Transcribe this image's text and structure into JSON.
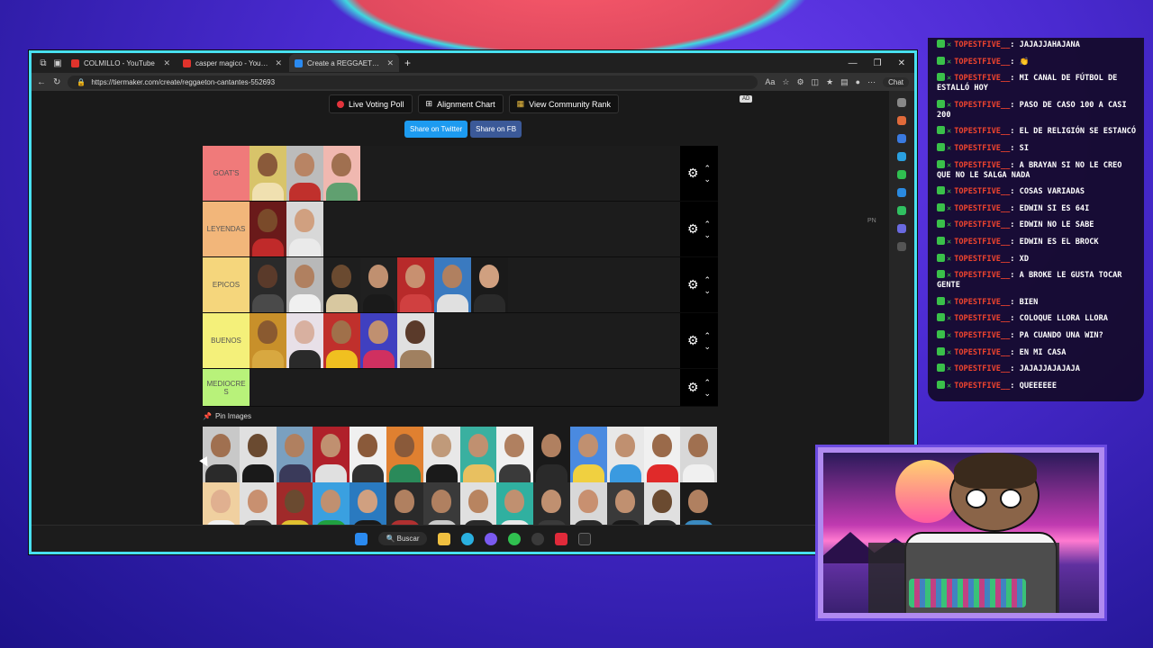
{
  "browser": {
    "tabs": [
      {
        "label": "COLMILLO - YouTube",
        "favicon": "youtube-icon",
        "active": false
      },
      {
        "label": "casper magico - YouTube",
        "favicon": "youtube-icon",
        "active": false
      },
      {
        "label": "Create a REGGAETON CANTANTE",
        "favicon": "tiermaker-icon",
        "active": true
      }
    ],
    "url": "https://tiermaker.com/create/reggaeton-cantantes-552693",
    "chat_button": "Chat"
  },
  "page": {
    "buttons": {
      "live_voting": "Live Voting Poll",
      "alignment": "Alignment Chart",
      "community_rank": "View Community Rank"
    },
    "share": {
      "twitter": "Share on Twitter",
      "facebook": "Share on FB"
    },
    "ad_tag": "AD",
    "pn_tag": "PN",
    "tiers": [
      {
        "label": "GOAT'S",
        "color": "#f07a7a",
        "images": [
          {
            "bg": "#d8c46a",
            "face": "#8a5a3a",
            "body": "#f0e0b0"
          },
          {
            "bg": "#bcbcbc",
            "face": "#b88464",
            "body": "#c0302c"
          },
          {
            "bg": "#f0b8b0",
            "face": "#a07050",
            "body": "#60a070"
          }
        ]
      },
      {
        "label": "LEYENDAS",
        "color": "#f2b67a",
        "images": [
          {
            "bg": "#6a1a1a",
            "face": "#7a4a2a",
            "body": "#c02a2a"
          },
          {
            "bg": "#d8d8d8",
            "face": "#d0a080",
            "body": "#eaeaea"
          }
        ]
      },
      {
        "label": "EPICOS",
        "color": "#f5d67c",
        "images": [
          {
            "bg": "#2a2a2a",
            "face": "#5a3a2a",
            "body": "#4a4a4a"
          },
          {
            "bg": "#b8b8b8",
            "face": "#b08060",
            "body": "#f0f0f0"
          },
          {
            "bg": "#1e1e1e",
            "face": "#6a4a30",
            "body": "#d8c8a0"
          },
          {
            "bg": "#202020",
            "face": "#c09070",
            "body": "#1a1a1a"
          },
          {
            "bg": "#b82a2a",
            "face": "#c89070",
            "body": "#d04040"
          },
          {
            "bg": "#3a7ac0",
            "face": "#b08060",
            "body": "#e0e0e0"
          },
          {
            "bg": "#1a1a1a",
            "face": "#d0a080",
            "body": "#2a2a2a"
          }
        ]
      },
      {
        "label": "BUENOS",
        "color": "#f4f07a",
        "images": [
          {
            "bg": "#c8902a",
            "face": "#8a5a30",
            "body": "#d8a840"
          },
          {
            "bg": "#e8e0e8",
            "face": "#d8b0a0",
            "body": "#2a2a2a"
          },
          {
            "bg": "#c0302c",
            "face": "#a0704a",
            "body": "#f0c020"
          },
          {
            "bg": "#4040c0",
            "face": "#c09070",
            "body": "#d03060"
          },
          {
            "bg": "#e0e0e0",
            "face": "#5a3a2a",
            "body": "#a08060"
          }
        ]
      },
      {
        "label": "MEDIOCRES",
        "color": "#b8f27a",
        "images": []
      }
    ],
    "pin_label": "Pin Images",
    "pool": [
      {
        "bg": "#c8c8c8",
        "face": "#a07050",
        "body": "#2a2a2a"
      },
      {
        "bg": "#e0e0e0",
        "face": "#6a4a30",
        "body": "#1a1a1a"
      },
      {
        "bg": "#7aa0c0",
        "face": "#b08060",
        "body": "#3a3a5a"
      },
      {
        "bg": "#b0202a",
        "face": "#c09070",
        "body": "#e0e0e0"
      },
      {
        "bg": "#f0f0f0",
        "face": "#8a5a3a",
        "body": "#303030"
      },
      {
        "bg": "#e08030",
        "face": "#8a5a3a",
        "body": "#2a8a5a"
      },
      {
        "bg": "#e8e8e8",
        "face": "#c09a7a",
        "body": "#1a1a1a"
      },
      {
        "bg": "#3ab0a0",
        "face": "#c09070",
        "body": "#e8c060"
      },
      {
        "bg": "#f0f0f0",
        "face": "#b08060",
        "body": "#3a3a3a"
      },
      {
        "bg": "#1a1a1a",
        "face": "#b08060",
        "body": "#2a2a2a"
      },
      {
        "bg": "#4a8ae0",
        "face": "#c09070",
        "body": "#f0d040"
      },
      {
        "bg": "#e8e8e8",
        "face": "#c09070",
        "body": "#3a9ae0"
      },
      {
        "bg": "#f0f0f0",
        "face": "#9a6a4a",
        "body": "#e02a2a"
      },
      {
        "bg": "#d8d8d8",
        "face": "#a07050",
        "body": "#f0f0f0"
      },
      {
        "bg": "#f0d0a0",
        "face": "#e0b090",
        "body": "#f0f0f0"
      },
      {
        "bg": "#e0e0e0",
        "face": "#c89070",
        "body": "#303030"
      },
      {
        "bg": "#a02a2a",
        "face": "#6a4a30",
        "body": "#e0c030"
      },
      {
        "bg": "#3aa0e0",
        "face": "#c09070",
        "body": "#20a040"
      },
      {
        "bg": "#2a7ac0",
        "face": "#d0a080",
        "body": "#1a1a1a"
      },
      {
        "bg": "#2a2a2a",
        "face": "#b08060",
        "body": "#b03030"
      },
      {
        "bg": "#3a3a3a",
        "face": "#b08060",
        "body": "#c8c8c8"
      },
      {
        "bg": "#e0e0e0",
        "face": "#b88460",
        "body": "#2a2a2a"
      },
      {
        "bg": "#30b0a0",
        "face": "#c09070",
        "body": "#e8e8e8"
      },
      {
        "bg": "#2a2a2a",
        "face": "#c09070",
        "body": "#3a3a3a"
      },
      {
        "bg": "#d8d8d8",
        "face": "#c89070",
        "body": "#2a2a2a"
      },
      {
        "bg": "#3a3a3a",
        "face": "#c09070",
        "body": "#1a1a1a"
      },
      {
        "bg": "#e0e0e0",
        "face": "#6a4a30",
        "body": "#2a2a2a"
      },
      {
        "bg": "#1a1a1a",
        "face": "#b08060",
        "body": "#3a8ac0"
      }
    ]
  },
  "taskbar": {
    "search_label": "Buscar"
  },
  "chat": {
    "user": "TOPESTFIVE__",
    "messages": [
      {
        "text": "JAJAJJAHAJANA"
      },
      {
        "text": "👏"
      },
      {
        "text": "MI CANAL DE FÚTBOL DE ESTALLÓ HOY"
      },
      {
        "text": "PASO DE CASO 100 A CASI 200"
      },
      {
        "text": "EL DE RELIGIÓN SE ESTANCÓ"
      },
      {
        "text": "SI"
      },
      {
        "text": "A BRAYAN SI NO LE CREO QUE NO LE SALGA NADA"
      },
      {
        "text": "COSAS VARIADAS"
      },
      {
        "text": "EDWIN SI ES 64I"
      },
      {
        "text": "EDWIN NO LE SABE"
      },
      {
        "text": "EDWIN ES EL BROCK"
      },
      {
        "text": "XD"
      },
      {
        "text": "A BROKE LE GUSTA TOCAR GENTE"
      },
      {
        "text": "BIEN"
      },
      {
        "text": "COLOQUE LLORA LLORA"
      },
      {
        "text": "PA CUANDO UNA WIN?"
      },
      {
        "text": "EN MI CASA"
      },
      {
        "text": "JAJAJJAJAJAJA"
      },
      {
        "text": "QUEEEEEE"
      }
    ]
  },
  "colors": {
    "browser_border": "#48e0f0",
    "chat_user": "#f0442e",
    "badge": "#3ac04a",
    "twitter": "#1d9bf0",
    "facebook": "#3b5998"
  }
}
